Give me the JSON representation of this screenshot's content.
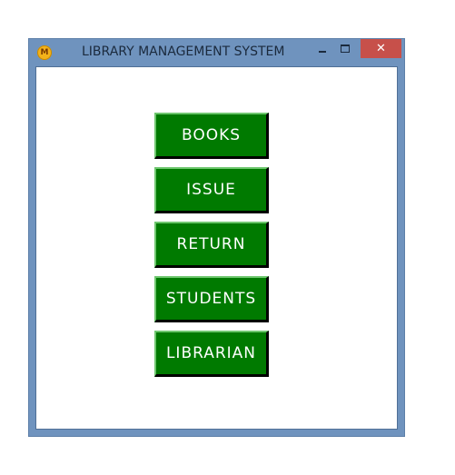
{
  "window": {
    "title": "LIBRARY MANAGEMENT SYSTEM",
    "app_icon_glyph": "M",
    "controls": {
      "minimize_icon": "minimize-icon",
      "maximize_icon": "maximize-icon",
      "close_label": "✕"
    }
  },
  "menu": {
    "buttons": [
      {
        "label": "BOOKS"
      },
      {
        "label": "ISSUE"
      },
      {
        "label": "RETURN"
      },
      {
        "label": "STUDENTS"
      },
      {
        "label": "LIBRARIAN"
      }
    ]
  },
  "colors": {
    "frame": "#6f93be",
    "close_button": "#c7504a",
    "button_fill": "#007a00",
    "button_text": "#ffffff"
  }
}
